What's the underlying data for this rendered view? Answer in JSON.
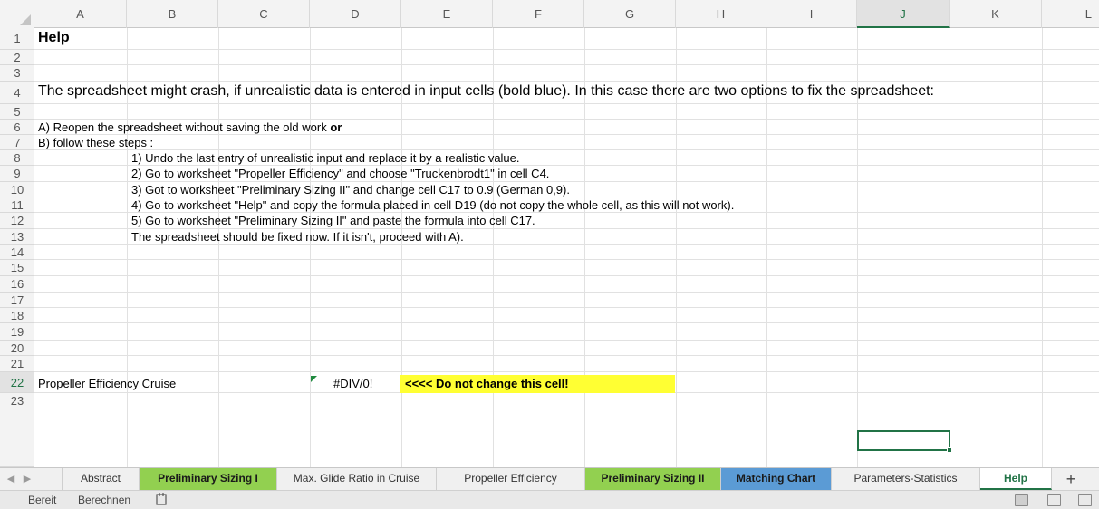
{
  "columns": [
    "A",
    "B",
    "C",
    "D",
    "E",
    "F",
    "G",
    "H",
    "I",
    "J",
    "K",
    "L"
  ],
  "rows": [
    "1",
    "2",
    "3",
    "4",
    "5",
    "6",
    "7",
    "8",
    "9",
    "10",
    "11",
    "12",
    "13",
    "14",
    "15",
    "16",
    "17",
    "18",
    "19",
    "20",
    "21",
    "22",
    "23"
  ],
  "selected_cell": "J22",
  "cells": {
    "A1": "Help",
    "A4": "The spreadsheet might crash, if unrealistic data is entered in input cells (bold blue). In this case there are two options to fix the spreadsheet:",
    "A6_text": "A) Reopen the spreadsheet without saving the old work ",
    "A6_bold": "or",
    "A7": "B) follow these steps :",
    "B8": "1) Undo the last entry of unrealistic input and replace it by a realistic value.",
    "B9": "2) Go to worksheet \"Propeller Efficiency\" and choose \"Truckenbrodt1\" in cell C4.",
    "B10": "3) Got to worksheet \"Preliminary Sizing II\" and change cell C17 to 0.9 (German 0,9).",
    "B11": "4) Go to worksheet \"Help\" and copy the formula placed in cell D19 (do not copy the whole cell, as this will not work).",
    "B12": "5) Go to worksheet \"Preliminary Sizing II\" and paste the formula into cell C17.",
    "B13": "The spreadsheet should be fixed now. If it isn't, proceed with A).",
    "A19": "Propeller Efficiency Cruise",
    "D19": "#DIV/0!",
    "E19": "<<<< Do not change this cell!"
  },
  "highlight_colors": {
    "warning_fill": "#ffff33",
    "selection": "#217346",
    "tab_green": "#92d050",
    "tab_blue": "#5b9bd5"
  },
  "sheet_tabs": [
    {
      "label": "Abstract",
      "style": "plain"
    },
    {
      "label": "Preliminary Sizing I",
      "style": "green"
    },
    {
      "label": "Max. Glide Ratio in Cruise",
      "style": "plain"
    },
    {
      "label": "Propeller Efficiency",
      "style": "plain"
    },
    {
      "label": "Preliminary Sizing II",
      "style": "green"
    },
    {
      "label": "Matching Chart",
      "style": "blue"
    },
    {
      "label": "Parameters-Statistics",
      "style": "plain"
    },
    {
      "label": "Help",
      "style": "active"
    }
  ],
  "tab_nav": {
    "prev_icon": "triangle-left-icon",
    "next_icon": "triangle-right-icon",
    "add_label": "+"
  },
  "status": {
    "ready": "Bereit",
    "calculate": "Berechnen",
    "record_icon": "macro-record-icon",
    "view_icons": [
      "normal-view-icon",
      "page-layout-view-icon",
      "page-break-view-icon"
    ]
  }
}
